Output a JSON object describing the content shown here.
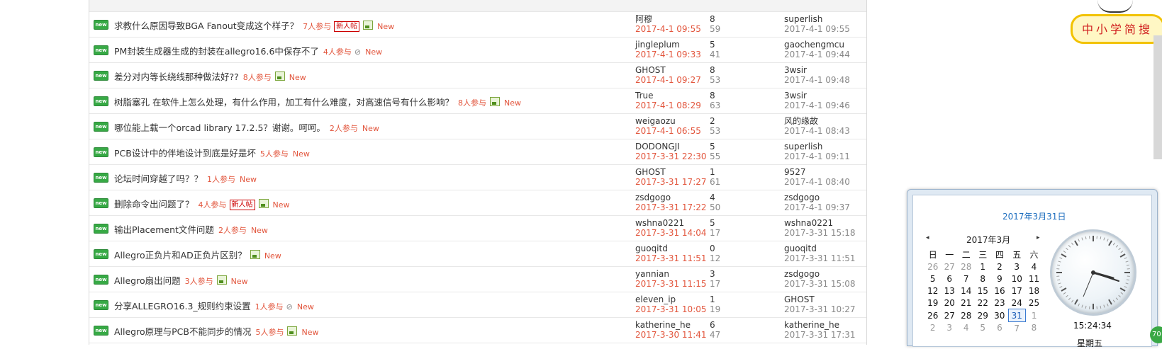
{
  "rows": [
    {
      "title": "求教什么原因导致BGA Fanout变成这个样子？",
      "participants": "7人参与",
      "newpost": "新人帖",
      "img": true,
      "clip": false,
      "new": "New",
      "author": "阿穆",
      "post_date": "2017-4-1 09:55",
      "replies": "8",
      "views": "59",
      "last_user": "superlish",
      "last_date": "2017-4-1 09:55"
    },
    {
      "title": "PM封装生成器生成的封装在allegro16.6中保存不了",
      "participants": "4人参与",
      "newpost": "",
      "img": false,
      "clip": true,
      "new": "New",
      "author": "jingleplum",
      "post_date": "2017-4-1 09:33",
      "replies": "5",
      "views": "41",
      "last_user": "gaochengmcu",
      "last_date": "2017-4-1 09:44"
    },
    {
      "title": "差分对内等长绕线那种做法好??",
      "participants": "8人参与",
      "newpost": "",
      "img": true,
      "clip": false,
      "new": "New",
      "author": "GHOST",
      "post_date": "2017-4-1 09:27",
      "replies": "8",
      "views": "53",
      "last_user": "3wsir",
      "last_date": "2017-4-1 09:48"
    },
    {
      "title": "树脂塞孔 在软件上怎么处理，有什么作用，加工有什么难度，对高速信号有什么影响？",
      "participants": "8人参与",
      "newpost": "",
      "img": true,
      "clip": false,
      "new": "New",
      "author": "True",
      "post_date": "2017-4-1 08:29",
      "replies": "8",
      "views": "63",
      "last_user": "3wsir",
      "last_date": "2017-4-1 09:46"
    },
    {
      "title": "哪位能上载一个orcad library 17.2.5？谢谢。呵呵。",
      "participants": "2人参与",
      "newpost": "",
      "img": false,
      "clip": false,
      "new": "New",
      "author": "weigaozu",
      "post_date": "2017-4-1 06:55",
      "replies": "2",
      "views": "53",
      "last_user": "风的缘故",
      "last_date": "2017-4-1 08:43"
    },
    {
      "title": "PCB设计中的伴地设计到底是好是坏",
      "participants": "5人参与",
      "newpost": "",
      "img": false,
      "clip": false,
      "new": "New",
      "author": "DODONGJI",
      "post_date": "2017-3-31 22:30",
      "replies": "5",
      "views": "55",
      "last_user": "superlish",
      "last_date": "2017-4-1 09:11"
    },
    {
      "title": "论坛时间穿越了吗？？",
      "participants": "1人参与",
      "newpost": "",
      "img": false,
      "clip": false,
      "new": "New",
      "author": "GHOST",
      "post_date": "2017-3-31 17:27",
      "replies": "1",
      "views": "61",
      "last_user": "9527",
      "last_date": "2017-4-1 08:40"
    },
    {
      "title": "删除命令出问题了？",
      "participants": "4人参与",
      "newpost": "新人帖",
      "img": true,
      "clip": false,
      "new": "New",
      "author": "zsdgogo",
      "post_date": "2017-3-31 17:22",
      "replies": "4",
      "views": "50",
      "last_user": "zsdgogo",
      "last_date": "2017-4-1 09:37"
    },
    {
      "title": "输出Placement文件问题",
      "participants": "2人参与",
      "newpost": "",
      "img": false,
      "clip": false,
      "new": "New",
      "author": "wshna0221",
      "post_date": "2017-3-31 14:04",
      "replies": "5",
      "views": "17",
      "last_user": "wshna0221",
      "last_date": "2017-3-31 15:18"
    },
    {
      "title": "Allegro正负片和AD正负片区别？",
      "participants": "",
      "newpost": "",
      "img": true,
      "clip": false,
      "new": "New",
      "author": "guoqitd",
      "post_date": "2017-3-31 11:51",
      "replies": "0",
      "views": "12",
      "last_user": "guoqitd",
      "last_date": "2017-3-31 11:51"
    },
    {
      "title": "Allegro扇出问题",
      "participants": "3人参与",
      "newpost": "",
      "img": true,
      "clip": false,
      "new": "New",
      "author": "yannian",
      "post_date": "2017-3-31 11:15",
      "replies": "3",
      "views": "17",
      "last_user": "zsdgogo",
      "last_date": "2017-3-31 15:08"
    },
    {
      "title": "分享ALLEGRO16.3_规则约束设置",
      "participants": "1人参与",
      "newpost": "",
      "img": false,
      "clip": true,
      "new": "New",
      "author": "eleven_ip",
      "post_date": "2017-3-31 10:05",
      "replies": "1",
      "views": "19",
      "last_user": "GHOST",
      "last_date": "2017-3-31 10:27"
    },
    {
      "title": "Allegro原理与PCB不能同步的情况",
      "participants": "5人参与",
      "newpost": "",
      "img": true,
      "clip": false,
      "new": "New",
      "author": "katherine_he",
      "post_date": "2017-3-30 11:41",
      "replies": "6",
      "views": "47",
      "last_user": "katherine_he",
      "last_date": "2017-3-31 17:31"
    }
  ],
  "new_icon_text": "new",
  "badge": {
    "text": "中小学简搜"
  },
  "gadget": {
    "date_title": "2017年3月31日",
    "month_label": "2017年3月",
    "prev": "◂",
    "next": "▸",
    "weekdays": [
      "日",
      "一",
      "二",
      "三",
      "四",
      "五",
      "六"
    ],
    "weeks": [
      [
        {
          "d": "26",
          "o": true
        },
        {
          "d": "27",
          "o": true
        },
        {
          "d": "28",
          "o": true
        },
        {
          "d": "1"
        },
        {
          "d": "2"
        },
        {
          "d": "3"
        },
        {
          "d": "4"
        }
      ],
      [
        {
          "d": "5"
        },
        {
          "d": "6"
        },
        {
          "d": "7"
        },
        {
          "d": "8"
        },
        {
          "d": "9"
        },
        {
          "d": "10"
        },
        {
          "d": "11"
        }
      ],
      [
        {
          "d": "12"
        },
        {
          "d": "13"
        },
        {
          "d": "14"
        },
        {
          "d": "15"
        },
        {
          "d": "16"
        },
        {
          "d": "17"
        },
        {
          "d": "18"
        }
      ],
      [
        {
          "d": "19"
        },
        {
          "d": "20"
        },
        {
          "d": "21"
        },
        {
          "d": "22"
        },
        {
          "d": "23"
        },
        {
          "d": "24"
        },
        {
          "d": "25"
        }
      ],
      [
        {
          "d": "26"
        },
        {
          "d": "27"
        },
        {
          "d": "28"
        },
        {
          "d": "29"
        },
        {
          "d": "30"
        },
        {
          "d": "31",
          "t": true
        },
        {
          "d": "1",
          "o": true
        }
      ],
      [
        {
          "d": "2",
          "o": true
        },
        {
          "d": "3",
          "o": true
        },
        {
          "d": "4",
          "o": true
        },
        {
          "d": "5",
          "o": true
        },
        {
          "d": "6",
          "o": true
        },
        {
          "d": "7",
          "o": true
        },
        {
          "d": "8",
          "o": true
        }
      ]
    ],
    "time": "15:24:34",
    "weekday": "星期五"
  },
  "green_badge": "70"
}
